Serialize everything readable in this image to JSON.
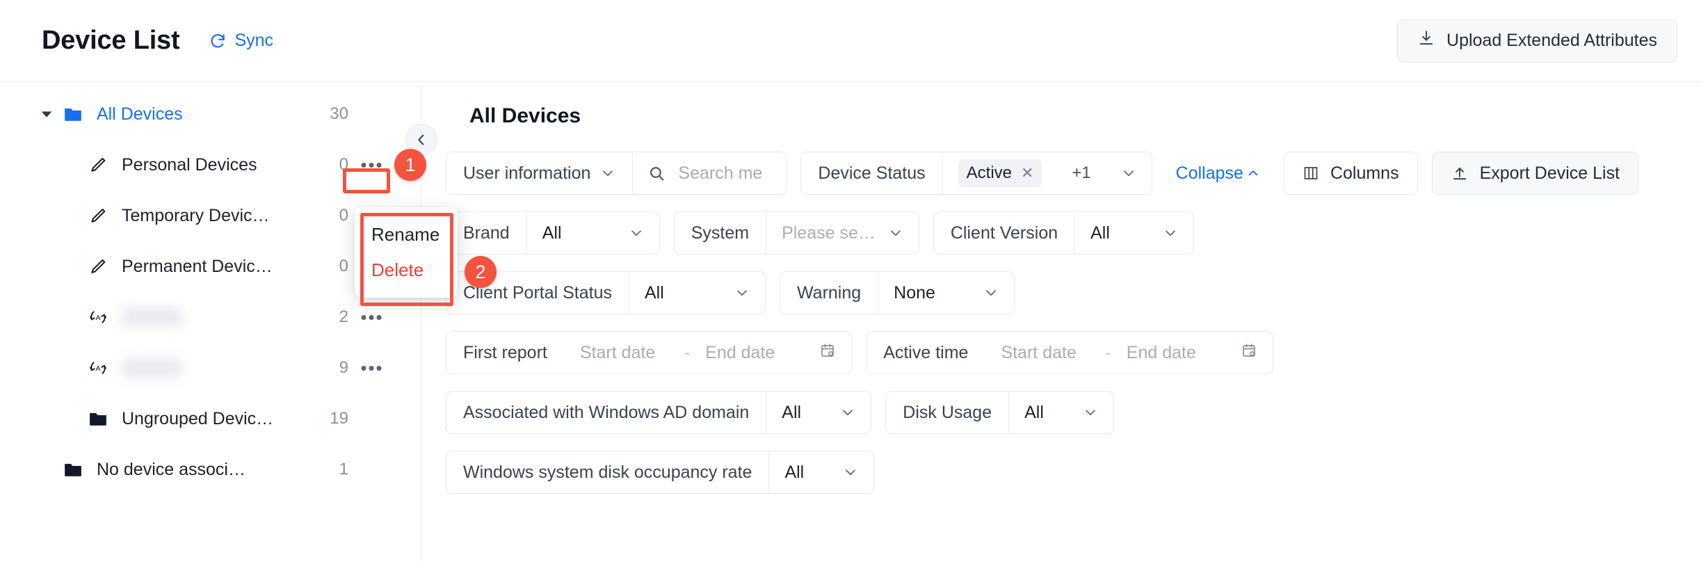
{
  "header": {
    "title": "Device List",
    "sync_label": "Sync",
    "sync_icon": "refresh-icon",
    "upload_button": "Upload Extended Attributes",
    "upload_icon": "download-tray-icon"
  },
  "sidebar": {
    "collapse_icon": "chevron-left-icon",
    "items": [
      {
        "label": "All Devices",
        "count": "30",
        "icon": "folder-icon-blue",
        "level": 1,
        "caret": true,
        "active": true,
        "dots": false,
        "blurred": false
      },
      {
        "label": "Personal Devices",
        "count": "0",
        "icon": "pencil-icon",
        "level": 2,
        "caret": false,
        "active": false,
        "dots": true,
        "blurred": false
      },
      {
        "label": "Temporary Devic…",
        "count": "0",
        "icon": "pencil-icon",
        "level": 2,
        "caret": false,
        "active": false,
        "dots": false,
        "blurred": false
      },
      {
        "label": "Permanent Devic…",
        "count": "0",
        "icon": "pencil-icon",
        "level": 2,
        "caret": false,
        "active": false,
        "dots": false,
        "blurred": false
      },
      {
        "label": "",
        "count": "2",
        "icon": "auto-group-icon",
        "level": 2,
        "caret": false,
        "active": false,
        "dots": true,
        "blurred": true
      },
      {
        "label": "",
        "count": "9",
        "icon": "auto-group-icon",
        "level": 2,
        "caret": false,
        "active": false,
        "dots": true,
        "blurred": true
      },
      {
        "label": "Ungrouped Devic…",
        "count": "19",
        "icon": "folder-icon-dark",
        "level": 2,
        "caret": false,
        "active": false,
        "dots": false,
        "blurred": false
      },
      {
        "label": "No device associ…",
        "count": "1",
        "icon": "folder-icon-dark",
        "level": 0,
        "caret": false,
        "active": false,
        "dots": false,
        "blurred": false
      }
    ]
  },
  "context_menu": {
    "rename": "Rename",
    "delete": "Delete"
  },
  "main": {
    "title": "All Devices",
    "search": {
      "scope_label": "User information",
      "placeholder": "Search me",
      "search_icon": "search-icon"
    },
    "device_status": {
      "label": "Device Status",
      "tag": "Active",
      "tag_remove_icon": "close-icon",
      "overflow": "+1"
    },
    "collapse_link": "Collapse",
    "columns_button": "Columns",
    "columns_icon": "columns-icon",
    "export_button": "Export Device List",
    "export_icon": "upload-tray-icon",
    "filters": [
      {
        "label": "Brand",
        "value": "All",
        "placeholder": false
      },
      {
        "label": "System",
        "value": "Please se…",
        "placeholder": true
      },
      {
        "label": "Client Version",
        "value": "All",
        "placeholder": false
      },
      {
        "label": "Client Portal Status",
        "value": "All",
        "placeholder": false
      },
      {
        "label": "Warning",
        "value": "None",
        "placeholder": false
      },
      {
        "label": "Associated with Windows AD domain",
        "value": "All",
        "placeholder": false
      },
      {
        "label": "Disk Usage",
        "value": "All",
        "placeholder": false
      },
      {
        "label": "Windows system disk occupancy rate",
        "value": "All",
        "placeholder": false
      }
    ],
    "date_filters": [
      {
        "label": "First report",
        "start": "Start date",
        "end": "End date",
        "dash": "-",
        "icon": "calendar-icon"
      },
      {
        "label": "Active time",
        "start": "Start date",
        "end": "End date",
        "dash": "-",
        "icon": "calendar-icon"
      }
    ]
  },
  "annotations": [
    {
      "number": "1"
    },
    {
      "number": "2"
    }
  ],
  "colors": {
    "accent_blue": "#1570ef",
    "annotation_red": "#f5533f",
    "danger_red": "#f0412f",
    "text_primary": "#1d222b",
    "text_muted": "#8b9099"
  }
}
